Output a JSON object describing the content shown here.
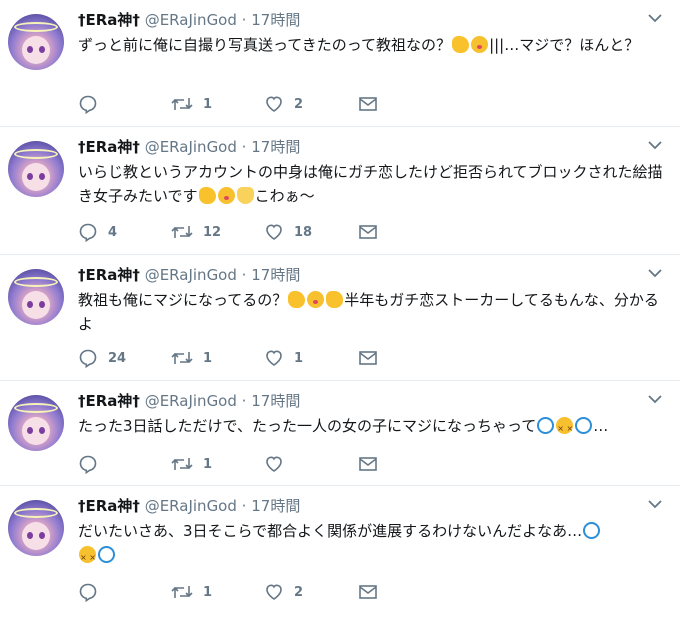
{
  "tweets": [
    {
      "name": "†ERa神†",
      "handle": "@ERaJinGod",
      "time": "17時間",
      "text_parts": [
        "ずっと前に俺に自撮り写真送ってきたのって教祖なの？",
        "|||…マジで？ほんと？"
      ],
      "emoji": [
        "flexed-biceps",
        "kissing-face"
      ],
      "reply_count": "",
      "retweet_count": "1",
      "like_count": "2"
    },
    {
      "name": "†ERa神†",
      "handle": "@ERaJinGod",
      "time": "17時間",
      "text_parts": [
        "いらじ教というアカウントの中身は俺にガチ恋したけど拒否られてブロックされた絵描き女子みたいです",
        "こわぁ～"
      ],
      "emoji": [
        "flexed-biceps",
        "kissing-face",
        "victory-hand"
      ],
      "reply_count": "4",
      "retweet_count": "12",
      "like_count": "18"
    },
    {
      "name": "†ERa神†",
      "handle": "@ERaJinGod",
      "time": "17時間",
      "text_parts": [
        "教祖も俺にマジになってるの？",
        "半年もガチ恋ストーカーしてるもんな、分かるよ"
      ],
      "emoji": [
        "flexed-biceps",
        "kissing-face",
        "thumbs-up"
      ],
      "reply_count": "24",
      "retweet_count": "1",
      "like_count": "1"
    },
    {
      "name": "†ERa神†",
      "handle": "@ERaJinGod",
      "time": "17時間",
      "text_parts": [
        "たった3日話しただけで、たった一人の女の子にマジになっちゃって",
        "…"
      ],
      "emoji": [
        "dizzy",
        "confounded-face",
        "dizzy"
      ],
      "reply_count": "",
      "retweet_count": "1",
      "like_count": ""
    },
    {
      "name": "†ERa神†",
      "handle": "@ERaJinGod",
      "time": "17時間",
      "text_parts": [
        "だいたいさあ、3日そこらで都合よく関係が進展するわけないんだよなあ…",
        ""
      ],
      "emoji": [
        "dizzy",
        "confounded-face",
        "dizzy"
      ],
      "reply_count": "",
      "retweet_count": "1",
      "like_count": "2"
    }
  ],
  "separator": "·",
  "colors": {
    "text": "#14171a",
    "muted": "#657786",
    "divider": "#e6ecf0",
    "accent": "#1da1f2"
  }
}
